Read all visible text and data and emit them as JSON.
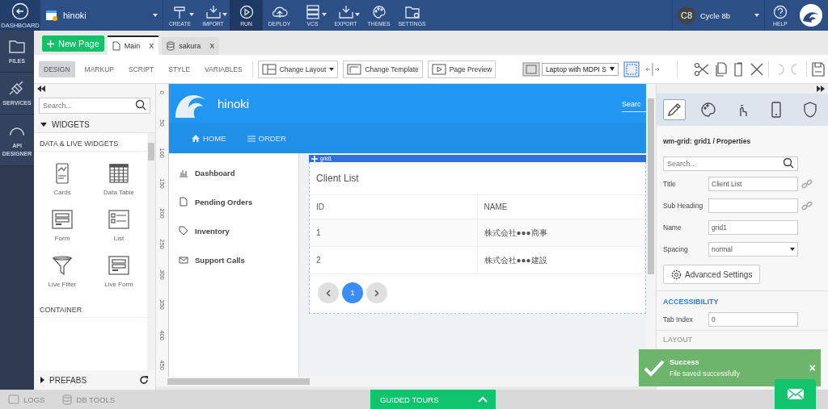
{
  "top_bar": {
    "dashboard": "DASHBOARD",
    "project": "hinoki",
    "tools": [
      {
        "label": "CREATE",
        "caret": true,
        "selected": false
      },
      {
        "label": "IMPORT",
        "caret": true,
        "selected": false
      },
      {
        "label": "RUN",
        "caret": false,
        "selected": true
      },
      {
        "label": "DEPLOY",
        "caret": false,
        "selected": false
      },
      {
        "label": "VCS",
        "caret": true,
        "selected": false
      },
      {
        "label": "EXPORT",
        "caret": true,
        "selected": false
      },
      {
        "label": "THEMES",
        "caret": false,
        "selected": false
      },
      {
        "label": "SETTINGS",
        "caret": false,
        "selected": false
      }
    ],
    "user": {
      "initials": "C8",
      "name": "Cycle 8b"
    },
    "help": "HELP"
  },
  "left_rail": [
    {
      "label": "FILES"
    },
    {
      "label": "SERVICES"
    },
    {
      "label": "API DESIGNER"
    }
  ],
  "page_tabs": {
    "new_page": "New Page",
    "tabs": [
      {
        "label": "Main",
        "selected": true,
        "close": "X"
      },
      {
        "label": "sakura",
        "selected": false,
        "close": "X"
      }
    ]
  },
  "mode_tabs": [
    {
      "label": "DESIGN",
      "selected": true
    },
    {
      "label": "MARKUP",
      "selected": false
    },
    {
      "label": "SCRIPT",
      "selected": false
    },
    {
      "label": "STYLE",
      "selected": false
    },
    {
      "label": "VARIABLES",
      "selected": false
    }
  ],
  "toolbar": {
    "buttons": [
      {
        "label": "Change Layout",
        "caret": true
      },
      {
        "label": "Change Template",
        "caret": false
      },
      {
        "label": "Page Preview",
        "caret": false
      }
    ],
    "device": "Laptop with MDPI S"
  },
  "widgets": {
    "search_placeholder": "Search...",
    "section": "WIDGETS",
    "group": "DATA & LIVE WIDGETS",
    "items": [
      {
        "label": "Cards"
      },
      {
        "label": "Data Table"
      },
      {
        "label": "Form"
      },
      {
        "label": "List"
      },
      {
        "label": "Live Filter"
      },
      {
        "label": "Live Form"
      }
    ],
    "container": "CONTAINER",
    "prefabs": "PREFABS"
  },
  "canvas": {
    "ruler": [
      "0",
      "50",
      "100",
      "150",
      "200",
      "250",
      "300",
      "350",
      "400",
      "450"
    ],
    "app_title": "hinoki",
    "search": "Searc",
    "nav": [
      {
        "label": "HOME"
      },
      {
        "label": "ORDER"
      }
    ],
    "side_nav": [
      {
        "label": "Dashboard"
      },
      {
        "label": "Pending Orders"
      },
      {
        "label": "Inventory"
      },
      {
        "label": "Support Calls"
      }
    ],
    "grid": {
      "tag": "grid1",
      "title": "Client List",
      "columns": [
        "ID",
        "NAME"
      ],
      "rows": [
        [
          "1",
          "株式会社●●●商事"
        ],
        [
          "2",
          "株式会社●●●建設"
        ]
      ],
      "pages": [
        {
          "label": "1",
          "selected": true
        }
      ]
    }
  },
  "properties": {
    "tabs": [
      {
        "selected": true
      },
      {
        "selected": false
      },
      {
        "selected": false
      },
      {
        "selected": false
      },
      {
        "selected": false
      }
    ],
    "heading": "wm-grid: grid1 / Properties",
    "search_placeholder": "Search...",
    "fields": [
      {
        "label": "Title",
        "kind": "text",
        "value": "Client List",
        "link": true
      },
      {
        "label": "Sub Heading",
        "kind": "text",
        "link": true
      },
      {
        "label": "Name",
        "kind": "text",
        "value": "grid1",
        "link": false
      },
      {
        "label": "Spacing",
        "kind": "select",
        "value": "normal",
        "link": false
      }
    ],
    "advanced": "Advanced Settings",
    "accessibility": "ACCESSIBILITY",
    "tab_index_label": "Tab Index",
    "tab_index": "0",
    "layout": "LAYOUT"
  },
  "toast": {
    "title": "Success",
    "message": "File saved successfully",
    "close": "×"
  },
  "bottom_bar": {
    "logs": "LOGS",
    "db_tools": "DB TOOLS",
    "guided_tours": "GUIDED TOURS"
  }
}
